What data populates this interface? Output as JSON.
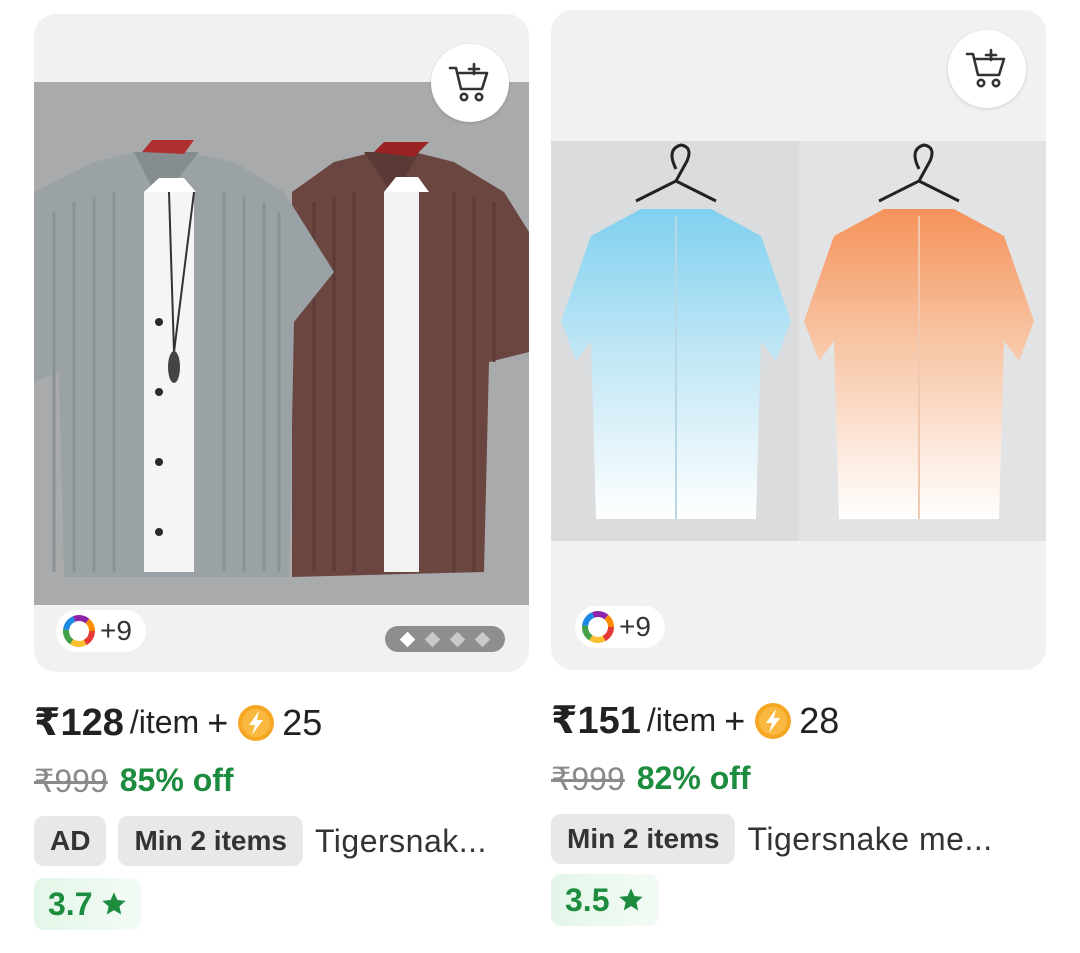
{
  "colors": {
    "accent_green": "#1d8c3f",
    "rating_bg": "#e3f6e8",
    "chip_bg": "#e8e8e8",
    "coin": "#f5a623"
  },
  "products": [
    {
      "price": "₹128",
      "per_item": "/item",
      "plus": "+",
      "coin_icon": "lightning-coin-icon",
      "coins": "25",
      "mrp": "₹999",
      "discount": "85% off",
      "ad_label": "AD",
      "min_items": "Min 2 items",
      "brand": "Tigersnak...",
      "rating": "3.7",
      "rating_icon": "star-icon",
      "swatch_count": "+9",
      "carousel_pages": 4,
      "carousel_active": 1
    },
    {
      "price": "₹151",
      "per_item": "/item",
      "plus": "+",
      "coin_icon": "lightning-coin-icon",
      "coins": "28",
      "mrp": "₹999",
      "discount": "82% off",
      "min_items": "Min 2 items",
      "brand": "Tigersnake me...",
      "rating": "3.5",
      "rating_icon": "star-icon",
      "swatch_count": "+9"
    }
  ]
}
